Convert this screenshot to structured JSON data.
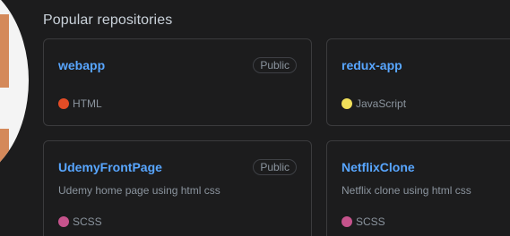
{
  "section": {
    "title": "Popular repositories"
  },
  "repos": [
    {
      "name": "webapp",
      "visibility": "Public",
      "description": "",
      "language": "HTML",
      "language_color": "#e34c26"
    },
    {
      "name": "redux-app",
      "visibility": "",
      "description": "",
      "language": "JavaScript",
      "language_color": "#f1e05a"
    },
    {
      "name": "UdemyFrontPage",
      "visibility": "Public",
      "description": "Udemy home page using html css",
      "language": "SCSS",
      "language_color": "#c6538c"
    },
    {
      "name": "NetflixClone",
      "visibility": "",
      "description": "Netflix clone using html css",
      "language": "SCSS",
      "language_color": "#c6538c"
    }
  ]
}
